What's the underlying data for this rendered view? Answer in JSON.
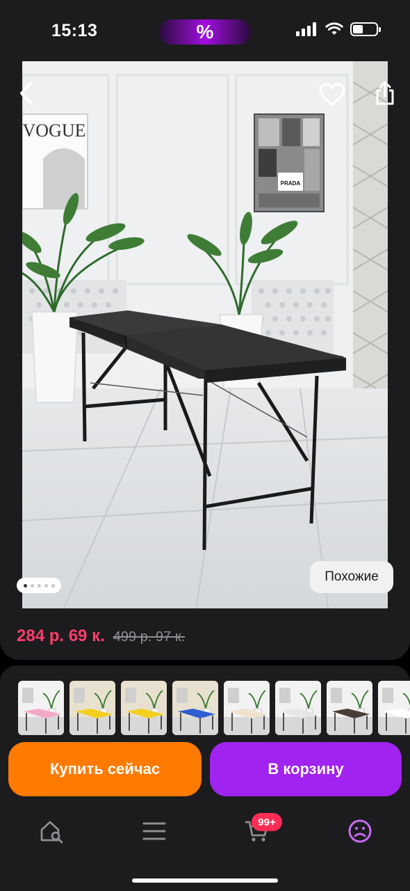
{
  "status_bar": {
    "time": "15:13",
    "promo_badge": "%",
    "icons": [
      "signal-icon",
      "wifi-icon",
      "battery-icon"
    ]
  },
  "product": {
    "photo_alt": "Массажный стол",
    "poster_left": "VOGUE",
    "poster_right": "PRADA",
    "nav": {
      "back_icon": "chevron-left-icon",
      "favorite_icon": "heart-icon",
      "share_icon": "share-icon"
    },
    "gallery": {
      "total_images": 5,
      "active_index": 0
    },
    "similar_label": "Похожие",
    "price": "284 р. 69 к.",
    "old_price": "499 р. 97 к."
  },
  "variants": [
    {
      "top_color": "#f2f2f2",
      "bed_color": "#f5a9c8",
      "legs_color": "#2b2b2b"
    },
    {
      "top_color": "#e9e1cf",
      "bed_color": "#f2cf1f",
      "legs_color": "#2b2b2b"
    },
    {
      "top_color": "#e9e1cf",
      "bed_color": "#f2cf1f",
      "legs_color": "#2b2b2b"
    },
    {
      "top_color": "#e9e1cf",
      "bed_color": "#2f5fd0",
      "legs_color": "#2b2b2b"
    },
    {
      "top_color": "#f2f2f2",
      "bed_color": "#efe2cc",
      "legs_color": "#2b2b2b"
    },
    {
      "top_color": "#f2f2f2",
      "bed_color": "#e6e6e6",
      "legs_color": "#2b2b2b"
    },
    {
      "top_color": "#f2f2f2",
      "bed_color": "#4a3d38",
      "legs_color": "#2b2b2b"
    },
    {
      "top_color": "#f2f2f2",
      "bed_color": "#ffffff",
      "legs_color": "#2b2b2b"
    }
  ],
  "actions": {
    "buy_now_label": "Купить сейчас",
    "add_to_cart_label": "В корзину"
  },
  "tab_bar": {
    "tabs": [
      {
        "icon": "home-search-icon",
        "active": false
      },
      {
        "icon": "menu-icon",
        "active": false
      },
      {
        "icon": "cart-icon",
        "active": false,
        "badge": "99+"
      },
      {
        "icon": "profile-icon",
        "active": true
      }
    ]
  },
  "colors": {
    "price": "#ff3d6b",
    "buy_now": "#ff7a00",
    "add_to_cart": "#a023f0",
    "active_tab": "#c56cf0",
    "badge": "#ff2d55"
  }
}
